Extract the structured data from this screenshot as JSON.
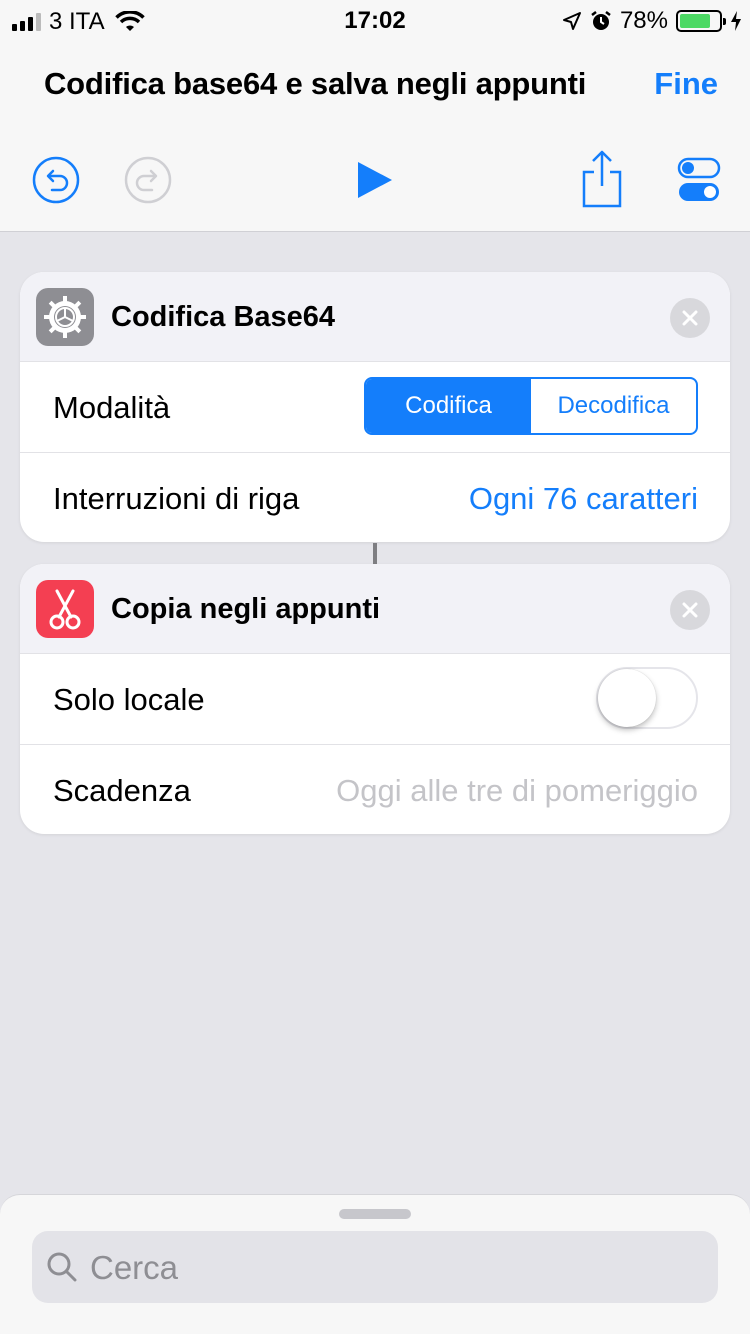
{
  "status_bar": {
    "carrier": "3 ITA",
    "time": "17:02",
    "battery": "78%",
    "battery_level": 0.78
  },
  "header": {
    "title": "Codifica base64 e salva negli appunti",
    "done_label": "Fine",
    "toolbar_icons": [
      "undo-icon",
      "redo-icon",
      "play-icon",
      "share-icon",
      "settings-toggles-icon"
    ]
  },
  "actions": [
    {
      "title": "Codifica Base64",
      "icon": "gear-icon",
      "icon_bg": "#8e8e93",
      "rows": {
        "mode_label": "Modalità",
        "mode_options": [
          "Codifica",
          "Decodifica"
        ],
        "mode_selected": "Codifica",
        "line_breaks_label": "Interruzioni di riga",
        "line_breaks_value": "Ogni 76 caratteri"
      }
    },
    {
      "title": "Copia negli appunti",
      "icon": "scissors-icon",
      "icon_bg": "#f43f52",
      "rows": {
        "local_only_label": "Solo locale",
        "local_only_on": false,
        "expiry_label": "Scadenza",
        "expiry_placeholder": "Oggi alle tre di pomeriggio"
      }
    }
  ],
  "search": {
    "placeholder": "Cerca"
  },
  "colors": {
    "accent": "#147efb",
    "background": "#e5e5ea"
  }
}
